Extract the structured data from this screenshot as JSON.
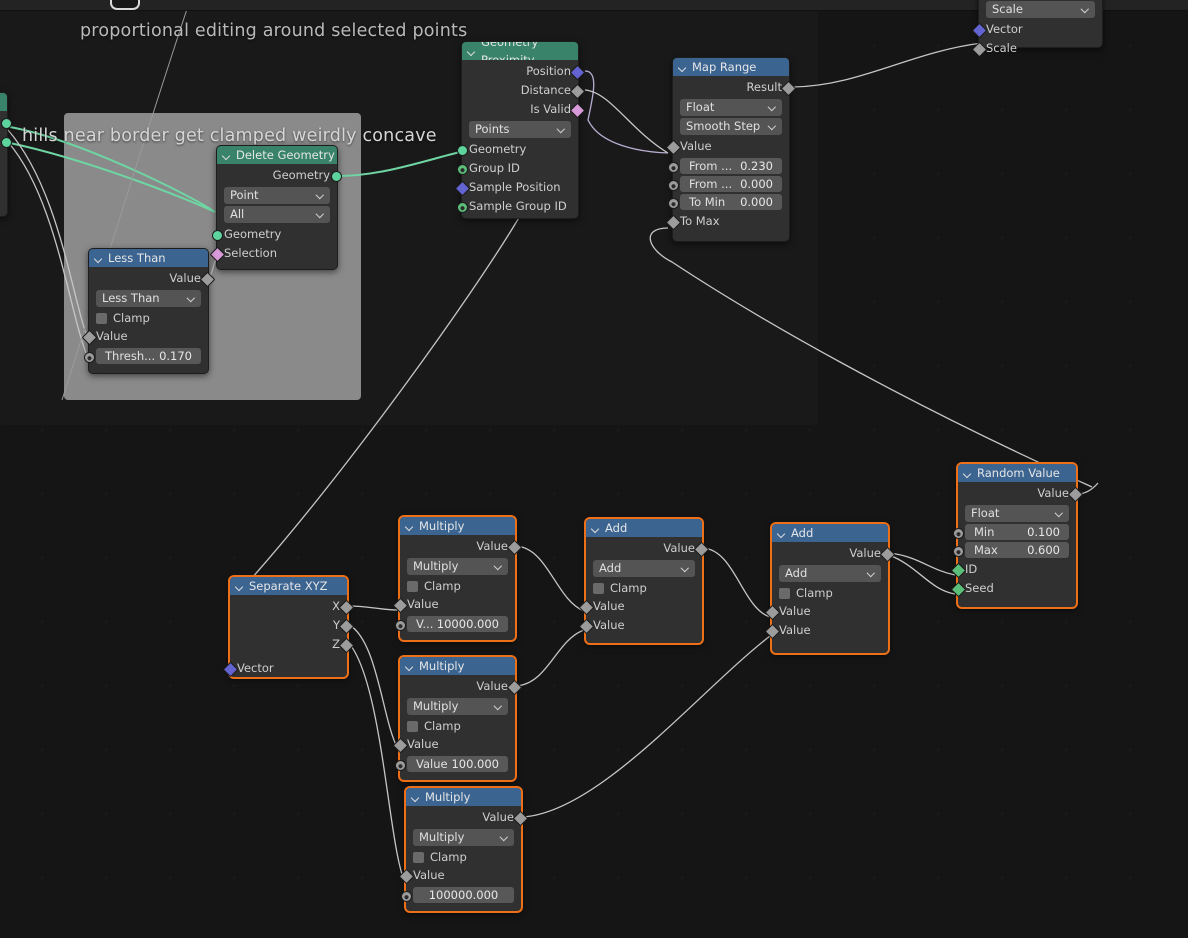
{
  "app": {
    "editor": "Geometry Node Editor",
    "background_color": "#151515",
    "frame_dark_color": "#191919",
    "frame_grey_color": "#8a8a8a",
    "selected_outline_color": "#ed7019",
    "header_blue": "#3b6491",
    "header_green": "#38836a"
  },
  "annotations": [
    {
      "text": "proportional editing around selected points"
    },
    {
      "text": "hills near border get clamped weirdly concave"
    }
  ],
  "nodes": {
    "vector_math_partial": {
      "dropdown": "Scale",
      "inputs": [
        "Vector",
        "Scale"
      ]
    },
    "geometry_proximity": {
      "title": "Geometry Proximity",
      "outputs": [
        "Position",
        "Distance",
        "Is Valid"
      ],
      "dropdown": "Points",
      "inputs": [
        "Geometry",
        "Group ID",
        "Sample Position",
        "Sample Group ID"
      ]
    },
    "map_range": {
      "title": "Map Range",
      "output": "Result",
      "data_type": "Float",
      "interpolation": "Smooth Step",
      "value_label": "Value",
      "fields": [
        {
          "label": "From ...",
          "value": "0.230"
        },
        {
          "label": "From ...",
          "value": "0.000"
        },
        {
          "label": "To Min",
          "value": "0.000"
        }
      ],
      "to_max_label": "To Max"
    },
    "delete_geometry": {
      "title": "Delete Geometry",
      "output": "Geometry",
      "domain": "Point",
      "mode": "All",
      "inputs": [
        "Geometry",
        "Selection"
      ]
    },
    "less_than": {
      "title": "Less Than",
      "output": "Value",
      "operation": "Less Than",
      "clamp_label": "Clamp",
      "input_value_label": "Value",
      "threshold": {
        "label": "Thresh...",
        "value": "0.170"
      }
    },
    "separate_xyz": {
      "title": "Separate XYZ",
      "outputs": [
        "X",
        "Y",
        "Z"
      ],
      "input": "Vector"
    },
    "multiply_1": {
      "title": "Multiply",
      "output": "Value",
      "operation": "Multiply",
      "clamp_label": "Clamp",
      "input_value_label": "Value",
      "field": {
        "label": "V...",
        "value": "10000.000"
      }
    },
    "multiply_2": {
      "title": "Multiply",
      "output": "Value",
      "operation": "Multiply",
      "clamp_label": "Clamp",
      "input_value_label": "Value",
      "field": {
        "label": "Value",
        "value": "100.000"
      }
    },
    "multiply_3": {
      "title": "Multiply",
      "output": "Value",
      "operation": "Multiply",
      "clamp_label": "Clamp",
      "input_value_label": "Value",
      "field": {
        "label": "",
        "value": "100000.000"
      }
    },
    "add_1": {
      "title": "Add",
      "output": "Value",
      "operation": "Add",
      "clamp_label": "Clamp",
      "inputs": [
        "Value",
        "Value"
      ]
    },
    "add_2": {
      "title": "Add",
      "output": "Value",
      "operation": "Add",
      "clamp_label": "Clamp",
      "inputs": [
        "Value",
        "Value"
      ]
    },
    "random_value": {
      "title": "Random Value",
      "output": "Value",
      "data_type": "Float",
      "fields": [
        {
          "label": "Min",
          "value": "0.100"
        },
        {
          "label": "Max",
          "value": "0.600"
        }
      ],
      "inputs": [
        "ID",
        "Seed"
      ]
    }
  }
}
